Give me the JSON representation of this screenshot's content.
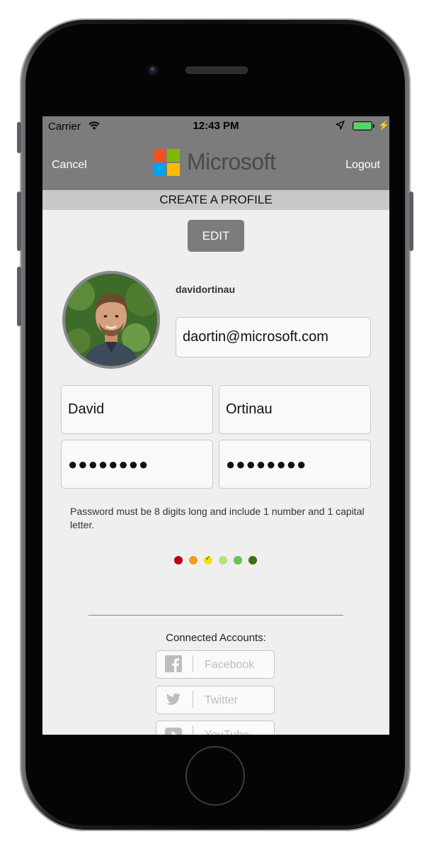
{
  "status_bar": {
    "carrier": "Carrier",
    "time": "12:43 PM",
    "battery_color": "#4cd964"
  },
  "nav": {
    "cancel": "Cancel",
    "logout": "Logout",
    "brand": "Microsoft",
    "logo_colors": [
      "#f25022",
      "#7fba00",
      "#00a4ef",
      "#ffb900"
    ]
  },
  "header": {
    "title": "CREATE A PROFILE"
  },
  "edit_button": "EDIT",
  "profile": {
    "username": "davidortinau",
    "email": "daortin@microsoft.com",
    "first_name": "David",
    "last_name": "Ortinau",
    "password": "●●●●●●●●",
    "password_confirm": "●●●●●●●●"
  },
  "password_hint": "Password must be 8 digits long and include 1 number and 1 capital letter.",
  "strength": {
    "colors": [
      "#c0001a",
      "#f39c1f",
      "#f5e11a",
      "#b4e27a",
      "#6cc24a",
      "#3a6e12"
    ],
    "selected_index": 2
  },
  "connected": {
    "title": "Connected Accounts:",
    "accounts": [
      {
        "label": "Facebook",
        "icon": "facebook-icon"
      },
      {
        "label": "Twitter",
        "icon": "twitter-icon"
      },
      {
        "label": "YouTube",
        "icon": "youtube-icon"
      }
    ]
  }
}
